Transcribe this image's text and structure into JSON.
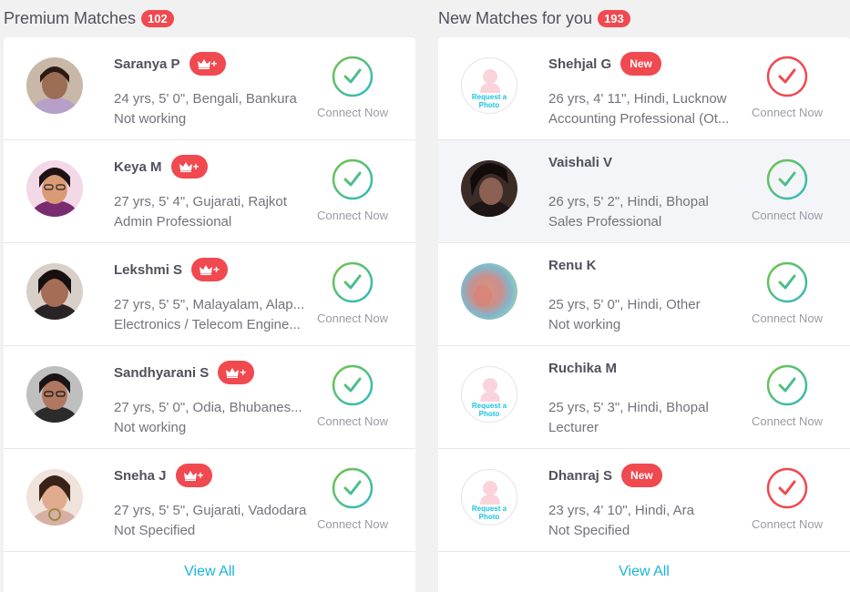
{
  "colors": {
    "accent": "#f0494f",
    "check_green": "#4fc191",
    "check_green_dark": "#72c442",
    "check_teal": "#2fb9c3",
    "link": "#19b4d9"
  },
  "left": {
    "title": "Premium Matches",
    "count": "102",
    "view_all": "View All",
    "items": [
      {
        "name": "Saranya P",
        "badge": "+",
        "line1": "24 yrs, 5' 0\", Bengali, Bankura",
        "line2": "Not working",
        "connect": "Connect Now",
        "icon": "check-icon"
      },
      {
        "name": "Keya M",
        "badge": "+",
        "line1": "27 yrs, 5' 4\", Gujarati, Rajkot",
        "line2": "Admin Professional",
        "connect": "Connect Now",
        "icon": "check-icon"
      },
      {
        "name": "Lekshmi S",
        "badge": "+",
        "line1": "27 yrs, 5' 5\", Malayalam, Alap...",
        "line2": "Electronics / Telecom Engine...",
        "connect": "Connect Now",
        "icon": "check-icon"
      },
      {
        "name": "Sandhyarani S",
        "badge": "+",
        "line1": "27 yrs, 5' 0\", Odia, Bhubanes...",
        "line2": "Not working",
        "connect": "Connect Now",
        "icon": "check-icon"
      },
      {
        "name": "Sneha J",
        "badge": "+",
        "line1": "27 yrs, 5' 5\", Gujarati, Vadodara",
        "line2": "Not Specified",
        "connect": "Connect Now",
        "icon": "check-icon"
      }
    ]
  },
  "right": {
    "title": "New Matches for you",
    "count": "193",
    "view_all": "View All",
    "request_photo": "Request a Photo",
    "items": [
      {
        "name": "Shehjal G",
        "badge": "New",
        "line1": "26 yrs, 4' 11\", Hindi, Lucknow",
        "line2": "Accounting Professional (Ot...",
        "connect": "Connect Now",
        "icon": "check-icon"
      },
      {
        "name": "Vaishali V",
        "badge": "",
        "line1": "26 yrs, 5' 2\", Hindi, Bhopal",
        "line2": "Sales Professional",
        "connect": "Connect Now",
        "icon": "check-icon"
      },
      {
        "name": "Renu K",
        "badge": "",
        "line1": "25 yrs, 5' 0\", Hindi, Other",
        "line2": "Not working",
        "connect": "Connect Now",
        "icon": "check-icon"
      },
      {
        "name": "Ruchika M",
        "badge": "",
        "line1": "25 yrs, 5' 3\", Hindi, Bhopal",
        "line2": "Lecturer",
        "connect": "Connect Now",
        "icon": "check-icon"
      },
      {
        "name": "Dhanraj S",
        "badge": "New",
        "line1": "23 yrs, 4' 10\", Hindi, Ara",
        "line2": "Not Specified",
        "connect": "Connect Now",
        "icon": "check-icon"
      }
    ]
  }
}
